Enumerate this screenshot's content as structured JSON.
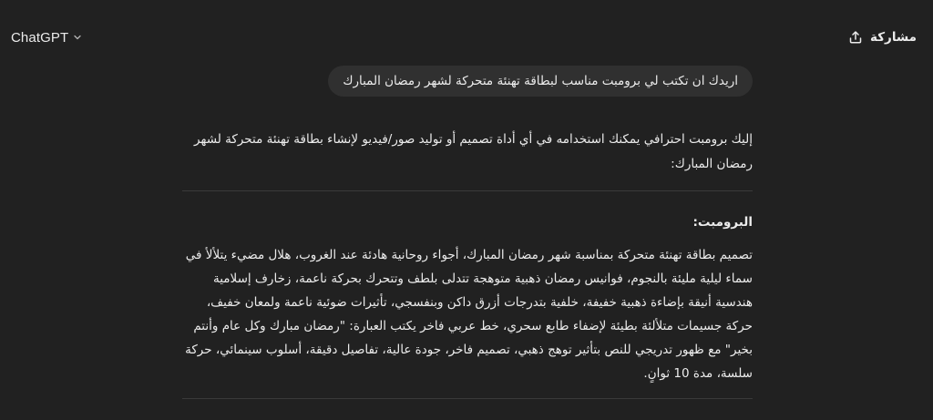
{
  "header": {
    "model_name": "ChatGPT",
    "share_label": "مشاركة"
  },
  "conversation": {
    "user_message": "اريدك ان تكتب لي برومبت مناسب لبطاقة تهنئة متحركة لشهر رمضان المبارك",
    "assistant": {
      "intro": "إليك برومبت احترافي يمكنك استخدامه في أي أداة تصميم أو توليد صور/فيديو لإنشاء بطاقة تهنئة متحركة لشهر رمضان المبارك:",
      "heading": "البرومبت:",
      "prompt_text": "تصميم بطاقة تهنئة متحركة بمناسبة شهر رمضان المبارك، أجواء روحانية هادئة عند الغروب، هلال مضيء يتلألأ في سماء ليلية مليئة بالنجوم، فوانيس رمضان ذهبية متوهجة تتدلى بلطف وتتحرك بحركة ناعمة، زخارف إسلامية هندسية أنيقة بإضاءة ذهبية خفيفة، خلفية بتدرجات أزرق داكن وبنفسجي، تأثيرات ضوئية ناعمة ولمعان خفيف، حركة جسيمات متلألئة بطيئة لإضفاء طابع سحري، خط عربي فاخر يكتب العبارة: \"رمضان مبارك وكل عام وأنتم بخير\" مع ظهور تدريجي للنص بتأثير توهج ذهبي، تصميم فاخر، جودة عالية، تفاصيل دقيقة، أسلوب سينمائي، حركة سلسة، مدة 10 ثوانٍ."
    }
  },
  "icons": {
    "model_chevron": "chevron-down-icon",
    "share": "share-upload-icon"
  },
  "colors": {
    "background": "#212121",
    "user_bubble": "#303030",
    "text": "#ececec",
    "divider": "#3a3a3a"
  }
}
